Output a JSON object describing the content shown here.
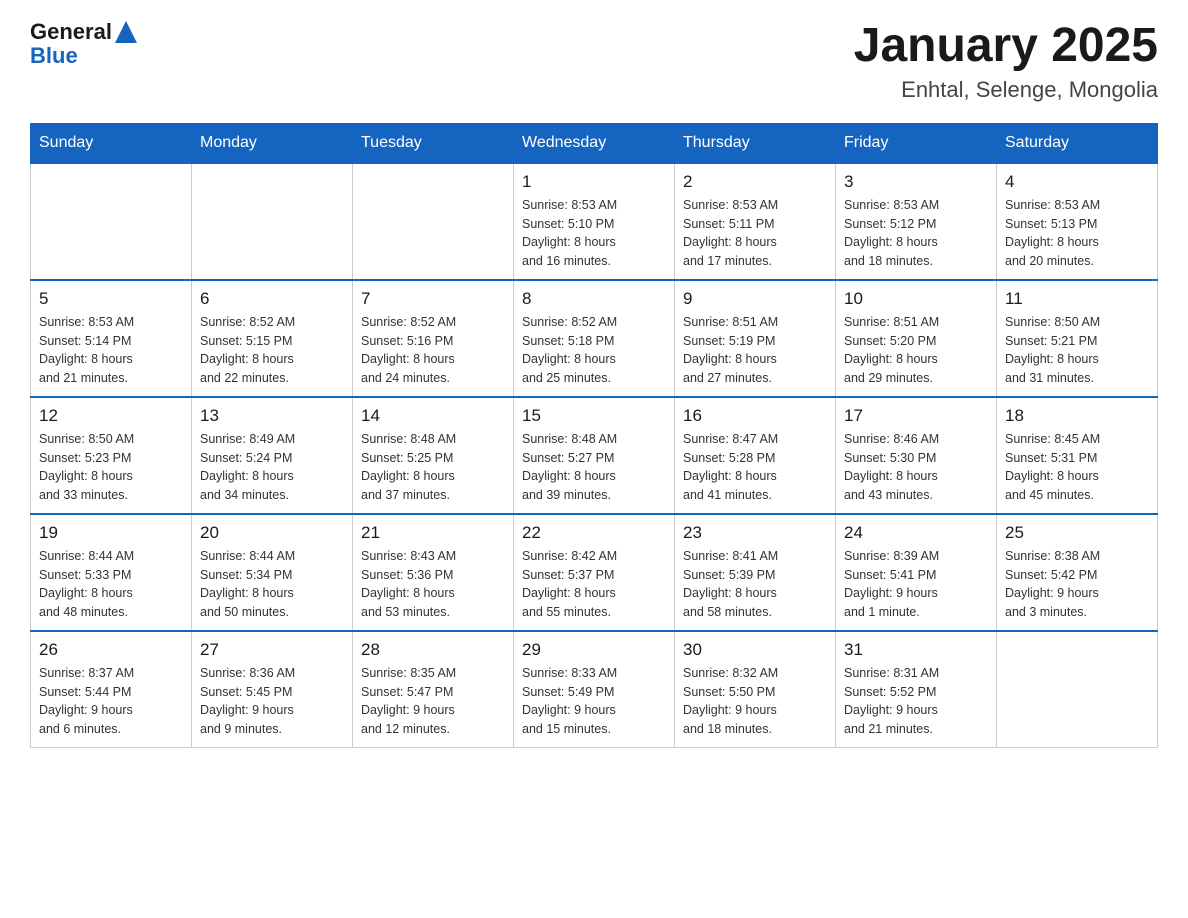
{
  "header": {
    "logo_general": "General",
    "logo_blue": "Blue",
    "title": "January 2025",
    "subtitle": "Enhtal, Selenge, Mongolia"
  },
  "days_of_week": [
    "Sunday",
    "Monday",
    "Tuesday",
    "Wednesday",
    "Thursday",
    "Friday",
    "Saturday"
  ],
  "weeks": [
    [
      {
        "day": "",
        "info": ""
      },
      {
        "day": "",
        "info": ""
      },
      {
        "day": "",
        "info": ""
      },
      {
        "day": "1",
        "info": "Sunrise: 8:53 AM\nSunset: 5:10 PM\nDaylight: 8 hours\nand 16 minutes."
      },
      {
        "day": "2",
        "info": "Sunrise: 8:53 AM\nSunset: 5:11 PM\nDaylight: 8 hours\nand 17 minutes."
      },
      {
        "day": "3",
        "info": "Sunrise: 8:53 AM\nSunset: 5:12 PM\nDaylight: 8 hours\nand 18 minutes."
      },
      {
        "day": "4",
        "info": "Sunrise: 8:53 AM\nSunset: 5:13 PM\nDaylight: 8 hours\nand 20 minutes."
      }
    ],
    [
      {
        "day": "5",
        "info": "Sunrise: 8:53 AM\nSunset: 5:14 PM\nDaylight: 8 hours\nand 21 minutes."
      },
      {
        "day": "6",
        "info": "Sunrise: 8:52 AM\nSunset: 5:15 PM\nDaylight: 8 hours\nand 22 minutes."
      },
      {
        "day": "7",
        "info": "Sunrise: 8:52 AM\nSunset: 5:16 PM\nDaylight: 8 hours\nand 24 minutes."
      },
      {
        "day": "8",
        "info": "Sunrise: 8:52 AM\nSunset: 5:18 PM\nDaylight: 8 hours\nand 25 minutes."
      },
      {
        "day": "9",
        "info": "Sunrise: 8:51 AM\nSunset: 5:19 PM\nDaylight: 8 hours\nand 27 minutes."
      },
      {
        "day": "10",
        "info": "Sunrise: 8:51 AM\nSunset: 5:20 PM\nDaylight: 8 hours\nand 29 minutes."
      },
      {
        "day": "11",
        "info": "Sunrise: 8:50 AM\nSunset: 5:21 PM\nDaylight: 8 hours\nand 31 minutes."
      }
    ],
    [
      {
        "day": "12",
        "info": "Sunrise: 8:50 AM\nSunset: 5:23 PM\nDaylight: 8 hours\nand 33 minutes."
      },
      {
        "day": "13",
        "info": "Sunrise: 8:49 AM\nSunset: 5:24 PM\nDaylight: 8 hours\nand 34 minutes."
      },
      {
        "day": "14",
        "info": "Sunrise: 8:48 AM\nSunset: 5:25 PM\nDaylight: 8 hours\nand 37 minutes."
      },
      {
        "day": "15",
        "info": "Sunrise: 8:48 AM\nSunset: 5:27 PM\nDaylight: 8 hours\nand 39 minutes."
      },
      {
        "day": "16",
        "info": "Sunrise: 8:47 AM\nSunset: 5:28 PM\nDaylight: 8 hours\nand 41 minutes."
      },
      {
        "day": "17",
        "info": "Sunrise: 8:46 AM\nSunset: 5:30 PM\nDaylight: 8 hours\nand 43 minutes."
      },
      {
        "day": "18",
        "info": "Sunrise: 8:45 AM\nSunset: 5:31 PM\nDaylight: 8 hours\nand 45 minutes."
      }
    ],
    [
      {
        "day": "19",
        "info": "Sunrise: 8:44 AM\nSunset: 5:33 PM\nDaylight: 8 hours\nand 48 minutes."
      },
      {
        "day": "20",
        "info": "Sunrise: 8:44 AM\nSunset: 5:34 PM\nDaylight: 8 hours\nand 50 minutes."
      },
      {
        "day": "21",
        "info": "Sunrise: 8:43 AM\nSunset: 5:36 PM\nDaylight: 8 hours\nand 53 minutes."
      },
      {
        "day": "22",
        "info": "Sunrise: 8:42 AM\nSunset: 5:37 PM\nDaylight: 8 hours\nand 55 minutes."
      },
      {
        "day": "23",
        "info": "Sunrise: 8:41 AM\nSunset: 5:39 PM\nDaylight: 8 hours\nand 58 minutes."
      },
      {
        "day": "24",
        "info": "Sunrise: 8:39 AM\nSunset: 5:41 PM\nDaylight: 9 hours\nand 1 minute."
      },
      {
        "day": "25",
        "info": "Sunrise: 8:38 AM\nSunset: 5:42 PM\nDaylight: 9 hours\nand 3 minutes."
      }
    ],
    [
      {
        "day": "26",
        "info": "Sunrise: 8:37 AM\nSunset: 5:44 PM\nDaylight: 9 hours\nand 6 minutes."
      },
      {
        "day": "27",
        "info": "Sunrise: 8:36 AM\nSunset: 5:45 PM\nDaylight: 9 hours\nand 9 minutes."
      },
      {
        "day": "28",
        "info": "Sunrise: 8:35 AM\nSunset: 5:47 PM\nDaylight: 9 hours\nand 12 minutes."
      },
      {
        "day": "29",
        "info": "Sunrise: 8:33 AM\nSunset: 5:49 PM\nDaylight: 9 hours\nand 15 minutes."
      },
      {
        "day": "30",
        "info": "Sunrise: 8:32 AM\nSunset: 5:50 PM\nDaylight: 9 hours\nand 18 minutes."
      },
      {
        "day": "31",
        "info": "Sunrise: 8:31 AM\nSunset: 5:52 PM\nDaylight: 9 hours\nand 21 minutes."
      },
      {
        "day": "",
        "info": ""
      }
    ]
  ]
}
